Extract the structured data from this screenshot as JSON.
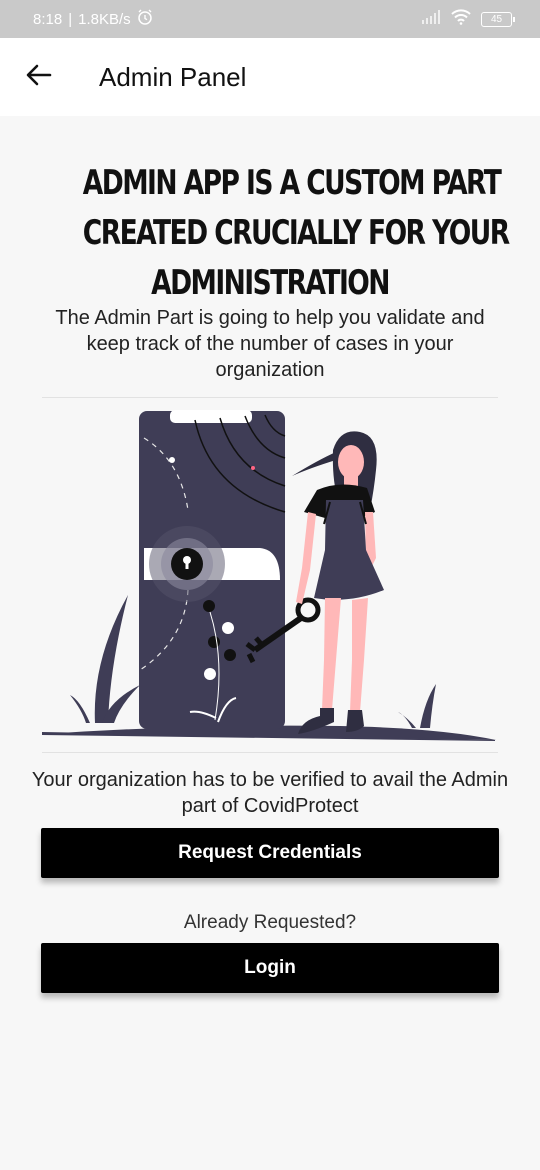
{
  "status_bar": {
    "time": "8:18",
    "separator": "|",
    "network_speed": "1.8KB/s",
    "alarm_icon": "alarm-icon",
    "signal_icon": "signal-icon",
    "wifi_icon": "wifi-icon",
    "battery_level": "45"
  },
  "app_bar": {
    "back_icon": "arrow-left-icon",
    "title": "Admin Panel"
  },
  "main": {
    "heading_lines": [
      "ADMIN APP IS A CUSTOM PART",
      "CREATED CRUCIALLY FOR YOUR",
      "ADMINISTRATION"
    ],
    "description": "The Admin Part is going to help you validate and keep track of the number of cases in your organization",
    "verify_text": "Your organization has to be verified to avail the Admin part of CovidProtect",
    "request_button_label": "Request Credentials",
    "already_requested_text": "Already Requested?",
    "login_button_label": "Login"
  },
  "colors": {
    "status_bar_bg": "#c9c9c9",
    "page_bg": "#f7f7f7",
    "button_bg": "#000000",
    "door_color": "#3f3d56",
    "skin_color": "#ffb8b8",
    "hair_color": "#2f2e41"
  }
}
